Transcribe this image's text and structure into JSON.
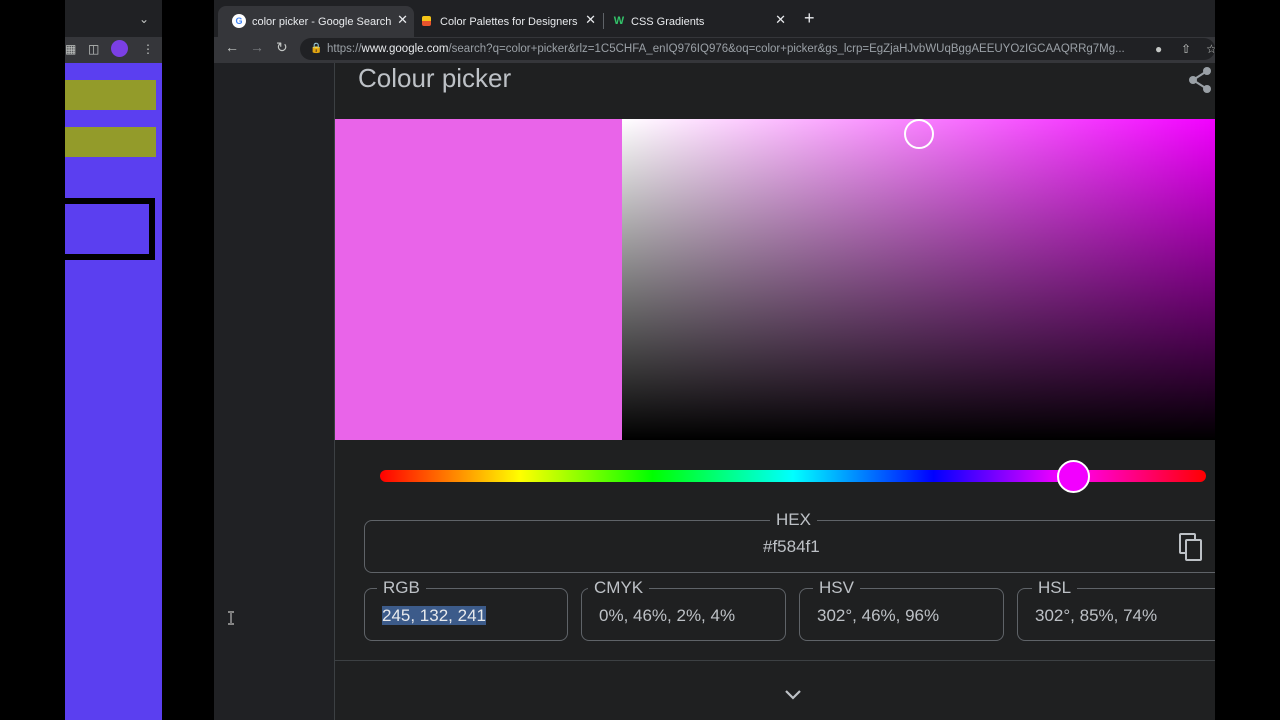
{
  "left_window": {
    "colors": {
      "bg": "#5b3ff0",
      "bar": "#939b2a"
    }
  },
  "tabs": [
    {
      "title": "color picker - Google Search",
      "favicon": "google-g-icon",
      "active": true
    },
    {
      "title": "Color Palettes for Designers an",
      "favicon": "palette-favicon-icon",
      "active": false
    },
    {
      "title": "CSS Gradients",
      "favicon": "w-favicon-icon",
      "active": false
    }
  ],
  "address_bar": {
    "scheme": "https://",
    "host": "www.google.com",
    "path": "/search?q=color+picker&rlz=1C5CHFA_enIQ976IQ976&oq=color+picker&gs_lcrp=EgZjaHJvbWUqBggAEEUYOzIGCAAQRRg7Mg..."
  },
  "picker": {
    "title": "Colour picker",
    "preview_color": "#e964e9",
    "hue_color": "#f200ff",
    "hue_position": 0.84,
    "sv_thumb": {
      "saturation": 0.5,
      "value": 0.96
    },
    "hex": {
      "label": "HEX",
      "value": "#f584f1"
    },
    "formats": [
      {
        "label": "RGB",
        "value": "245, 132, 241"
      },
      {
        "label": "CMYK",
        "value": "0%, 46%, 2%, 4%"
      },
      {
        "label": "HSV",
        "value": "302°, 46%, 96%"
      },
      {
        "label": "HSL",
        "value": "302°, 85%, 74%"
      }
    ]
  }
}
